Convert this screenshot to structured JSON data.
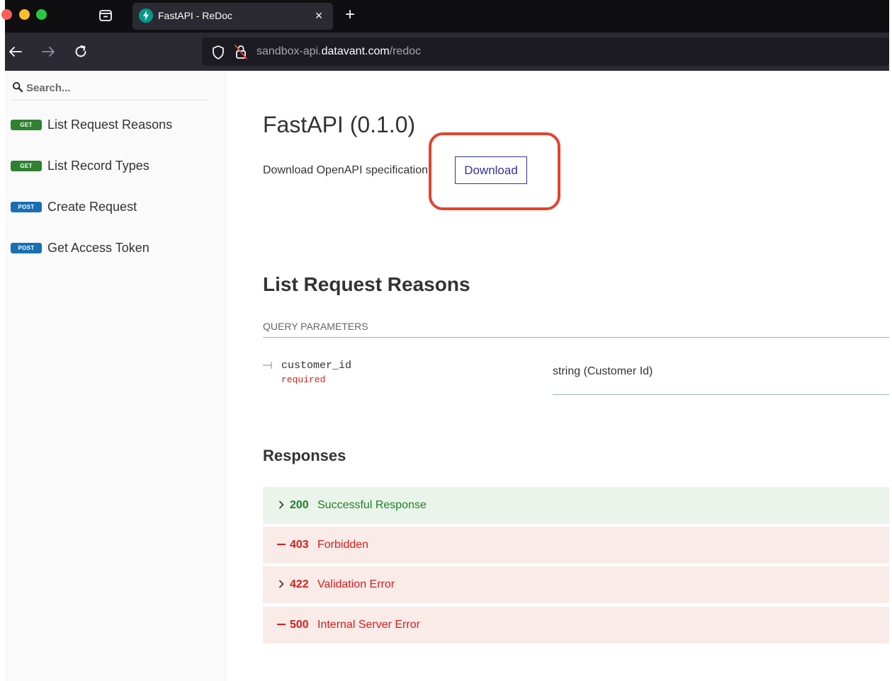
{
  "browser": {
    "tab": {
      "title": "FastAPI - ReDoc",
      "close_glyph": "×",
      "favicon_color": "#05998b"
    },
    "new_tab_glyph": "+",
    "url": {
      "prefix": "sandbox-api.",
      "host": "datavant.com",
      "path": "/redoc"
    }
  },
  "sidebar": {
    "search": {
      "placeholder": "Search..."
    },
    "items": [
      {
        "method": "GET",
        "label": "List Request Reasons"
      },
      {
        "method": "GET",
        "label": "List Record Types"
      },
      {
        "method": "POST",
        "label": "Create Request"
      },
      {
        "method": "POST",
        "label": "Get Access Token"
      }
    ]
  },
  "main": {
    "title": "FastAPI (0.1.0)",
    "download": {
      "label": "Download OpenAPI specification:",
      "button": "Download"
    },
    "operation": {
      "title": "List Request Reasons",
      "params_header": "QUERY PARAMETERS",
      "param": {
        "name": "customer_id",
        "required": "required",
        "type": "string (Customer Id)"
      },
      "responses_title": "Responses",
      "responses": [
        {
          "code": "200",
          "text": "Successful Response",
          "kind": "success",
          "icon": "chevron-right"
        },
        {
          "code": "403",
          "text": "Forbidden",
          "kind": "error",
          "icon": "dash"
        },
        {
          "code": "422",
          "text": "Validation Error",
          "kind": "error",
          "icon": "chevron-right"
        },
        {
          "code": "500",
          "text": "Internal Server Error",
          "kind": "error",
          "icon": "dash"
        }
      ]
    }
  },
  "colors": {
    "get_badge": "#2f8132",
    "post_badge": "#186fb2",
    "success_text": "#1d8127",
    "error_text": "#d41f1c",
    "highlight": "#e3432e",
    "link": "#32329f"
  }
}
